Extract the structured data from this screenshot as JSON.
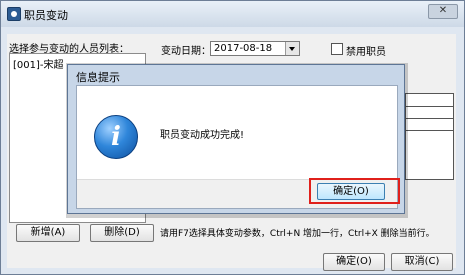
{
  "window": {
    "title": "职员变动",
    "close_label": "✕"
  },
  "left_panel": {
    "label": "选择参与变动的人员列表：",
    "items": [
      "[001]-宋超"
    ]
  },
  "form": {
    "date_label": "变动日期：",
    "date_value": "2017-08-18",
    "disable_label": "禁用职员"
  },
  "buttons": {
    "add": "新增(A)",
    "delete": "删除(D)",
    "ok": "确定(O)",
    "cancel": "取消(C)"
  },
  "hint": "请用F7选择具体变动参数，Ctrl+N 增加一行，Ctrl+X 删除当前行。",
  "dialog": {
    "title": "信息提示",
    "message": "职员变动成功完成!",
    "ok": "确定(O)",
    "highlight_color": "#e0201b"
  }
}
